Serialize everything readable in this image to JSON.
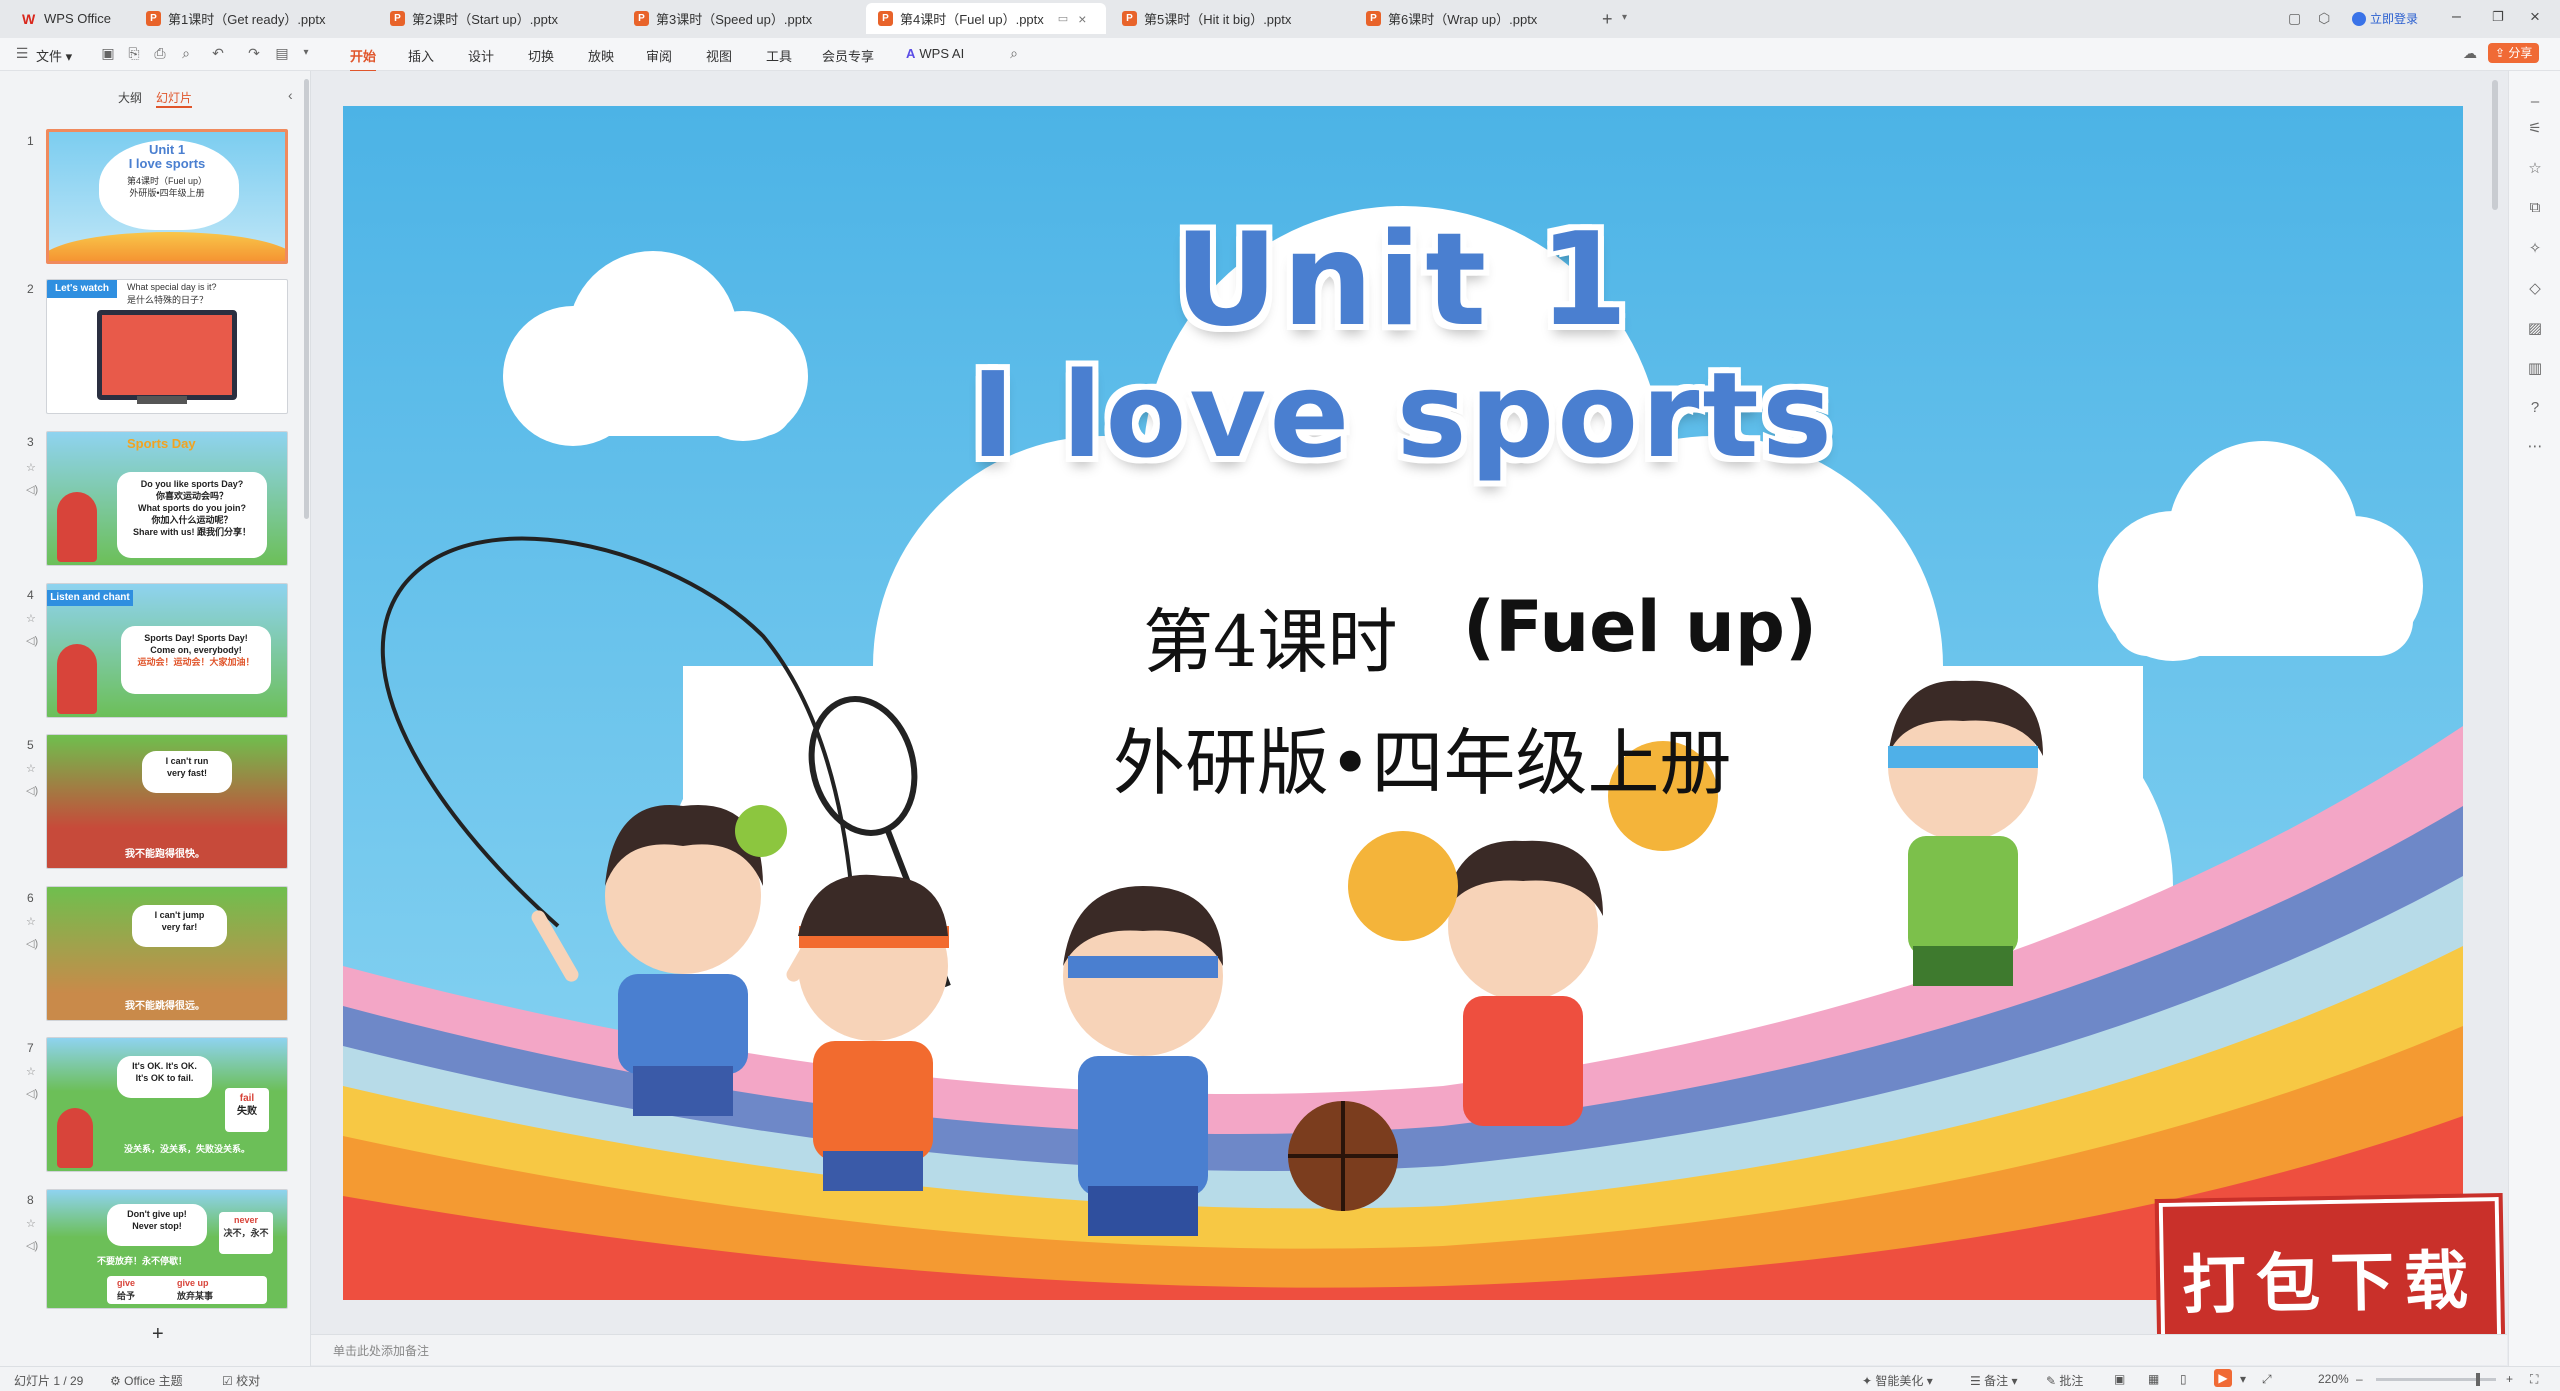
{
  "tabs": [
    {
      "label": "WPS Office",
      "active": false
    },
    {
      "label": "第1课时（Get ready）.pptx",
      "active": false
    },
    {
      "label": "第2课时（Start up）.pptx",
      "active": false
    },
    {
      "label": "第3课时（Speed up）.pptx",
      "active": false
    },
    {
      "label": "第4课时（Fuel up）.pptx",
      "active": true
    },
    {
      "label": "第5课时（Hit it big）.pptx",
      "active": false
    },
    {
      "label": "第6课时（Wrap up）.pptx",
      "active": false
    }
  ],
  "login_label": "立即登录",
  "share_label": "分享",
  "menu": {
    "file": "文件",
    "items": [
      "开始",
      "插入",
      "设计",
      "切换",
      "放映",
      "审阅",
      "视图",
      "工具",
      "会员专享"
    ],
    "ai": "WPS AI"
  },
  "panel_tabs": {
    "outline": "大纲",
    "slides": "幻灯片"
  },
  "thumbnails": [
    {
      "num": "1",
      "lines": [
        "Unit 1",
        "I love sports",
        "第4课时（Fuel up）",
        "外研版•四年级上册"
      ]
    },
    {
      "num": "2",
      "tag": "Let's watch",
      "lines": [
        "What special day is it?",
        "是什么特殊的日子？"
      ]
    },
    {
      "num": "3",
      "tag": "Sports Day",
      "lines": [
        "Do you like sports Day?",
        "你喜欢运动会吗？",
        "What sports do you join?",
        "你加入什么运动呢？",
        "Share with us!",
        "跟我们分享！"
      ]
    },
    {
      "num": "4",
      "tag": "Listen and chant",
      "lines": [
        "Sports Day! Sports Day!",
        "Come on, everybody!",
        "运动会！运动会！大家加油！"
      ]
    },
    {
      "num": "5",
      "lines": [
        "I can't run",
        "very fast!",
        "我不能跑得很快。"
      ]
    },
    {
      "num": "6",
      "lines": [
        "I can't jump",
        "very far!",
        "我不能跳得很远。"
      ]
    },
    {
      "num": "7",
      "lines": [
        "It's OK. It's OK.",
        "It's OK to fail.",
        "fail",
        "失败",
        "没关系，没关系，失败没关系。"
      ]
    },
    {
      "num": "8",
      "lines": [
        "Don't give up!",
        "Never stop!",
        "不要放弃！永不停歇！",
        "never",
        "决不，永不",
        "give",
        "give up",
        "给予",
        "放弃某事"
      ]
    }
  ],
  "slide": {
    "title_line1": "Unit 1",
    "title_line2": "I love sports",
    "lesson_cn": "第4课时",
    "lesson_en": "(Fuel up)",
    "publisher": "外研版•四年级上册",
    "stamp": "打包下载"
  },
  "notes_placeholder": "单击此处添加备注",
  "status": {
    "slide_count": "幻灯片 1 / 29",
    "theme": "Office 主题",
    "proof": "校对",
    "smart": "智能美化",
    "notes": "备注",
    "comments": "批注",
    "zoom": "220%"
  },
  "colors": {
    "accent": "#e0552b",
    "sky": "#56b9e8",
    "title_blue": "#4a7fd0"
  }
}
